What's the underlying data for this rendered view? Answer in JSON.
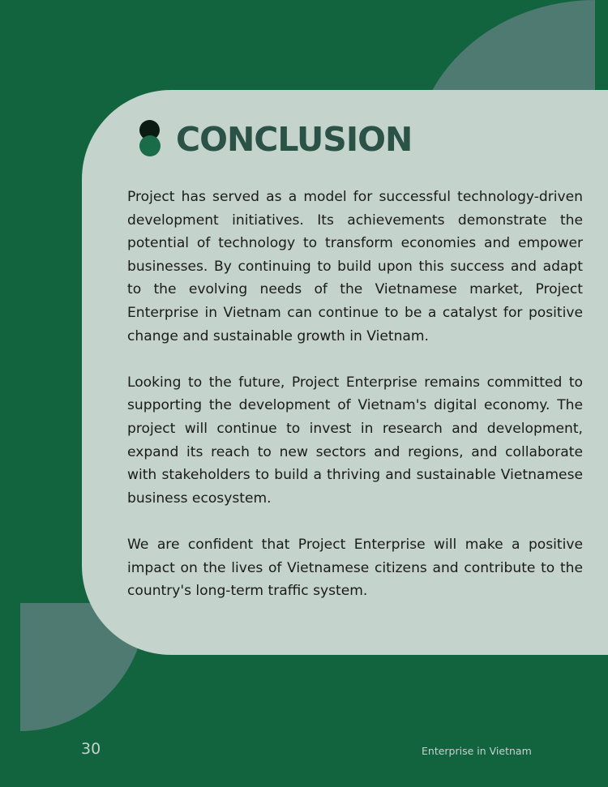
{
  "page": {
    "heading": "CONCLUSION",
    "paragraphs": [
      "Project has served as a model for successful technology-driven development initiatives. Its achievements demonstrate the potential of technology to transform economies and empower businesses. By continuing to build upon this success and adapt to the evolving needs of the Vietnamese market, Project Enterprise  in Vietnam can continue to be a catalyst for positive change and sustainable growth in Vietnam.",
      "Looking to the future, Project Enterprise remains committed to supporting the development of Vietnam's digital economy. The project will continue to invest in research and development, expand its reach to new sectors and regions, and collaborate with stakeholders to build a thriving and sustainable Vietnamese business ecosystem.",
      "We are confident that Project Enterprise will  make a positive impact on the lives of Vietnamese citizens and contribute to the country's long-term traffic system."
    ]
  },
  "footer": {
    "page_number": "30",
    "caption": "Enterprise in Vietnam"
  },
  "colors": {
    "background": "#12643f",
    "card": "#c4d3cb",
    "accent_shape": "#4f7a72",
    "heading": "#2b5247",
    "marker_dark": "#0b1b13",
    "marker_green": "#1a6b47",
    "body_text": "#1b1b1b"
  },
  "icons": {
    "heading_marker": "stacked-dots-icon"
  }
}
